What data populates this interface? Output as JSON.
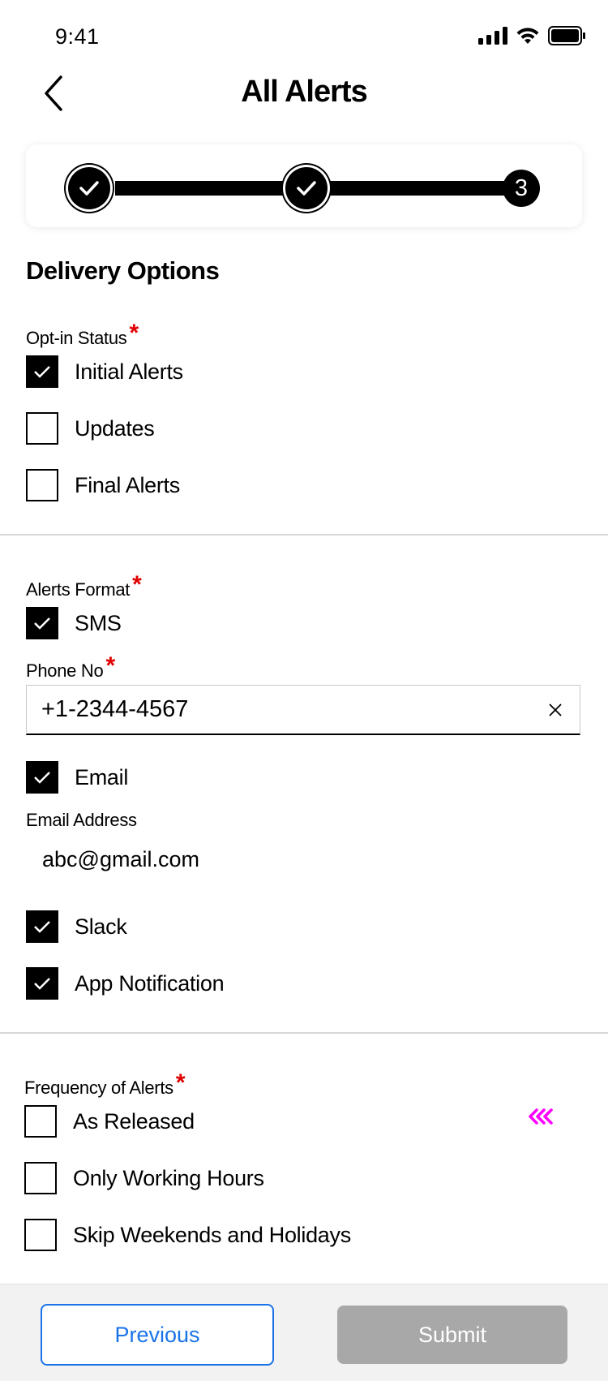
{
  "status_bar": {
    "time": "9:41",
    "icons": [
      "signal-icon",
      "wifi-icon",
      "battery-icon"
    ]
  },
  "header": {
    "title": "All Alerts",
    "back_icon": "chevron-left-icon"
  },
  "stepper": {
    "steps": [
      {
        "state": "done",
        "icon": "check-icon"
      },
      {
        "state": "done",
        "icon": "check-icon"
      },
      {
        "state": "current",
        "label": "3"
      }
    ]
  },
  "section": {
    "title": "Delivery Options"
  },
  "opt_in": {
    "label": "Opt-in Status",
    "required_mark": "*",
    "options": [
      {
        "label": "Initial Alerts",
        "checked": true
      },
      {
        "label": "Updates",
        "checked": false
      },
      {
        "label": "Final Alerts",
        "checked": false
      }
    ]
  },
  "alerts_format": {
    "label": "Alerts Format",
    "required_mark": "*",
    "sms": {
      "label": "SMS",
      "checked": true
    },
    "phone": {
      "label": "Phone No",
      "required_mark": "*",
      "value": "+1-2344-4567"
    },
    "email": {
      "label": "Email",
      "checked": true
    },
    "email_address": {
      "label": "Email Address",
      "value": "abc@gmail.com"
    },
    "slack": {
      "label": "Slack",
      "checked": true
    },
    "app_notification": {
      "label": "App Notification",
      "checked": true
    }
  },
  "frequency": {
    "label": "Frequency of Alerts",
    "required_mark": "*",
    "options": [
      {
        "label": "As Released",
        "checked": false
      },
      {
        "label": "Only Working Hours",
        "checked": false
      },
      {
        "label": "Skip Weekends and Holidays",
        "checked": false
      }
    ],
    "accent_color": "#ff00ff"
  },
  "footer": {
    "previous_label": "Previous",
    "submit_label": "Submit",
    "previous_color": "#1a73e8",
    "submit_color": "#a8a8a8"
  }
}
